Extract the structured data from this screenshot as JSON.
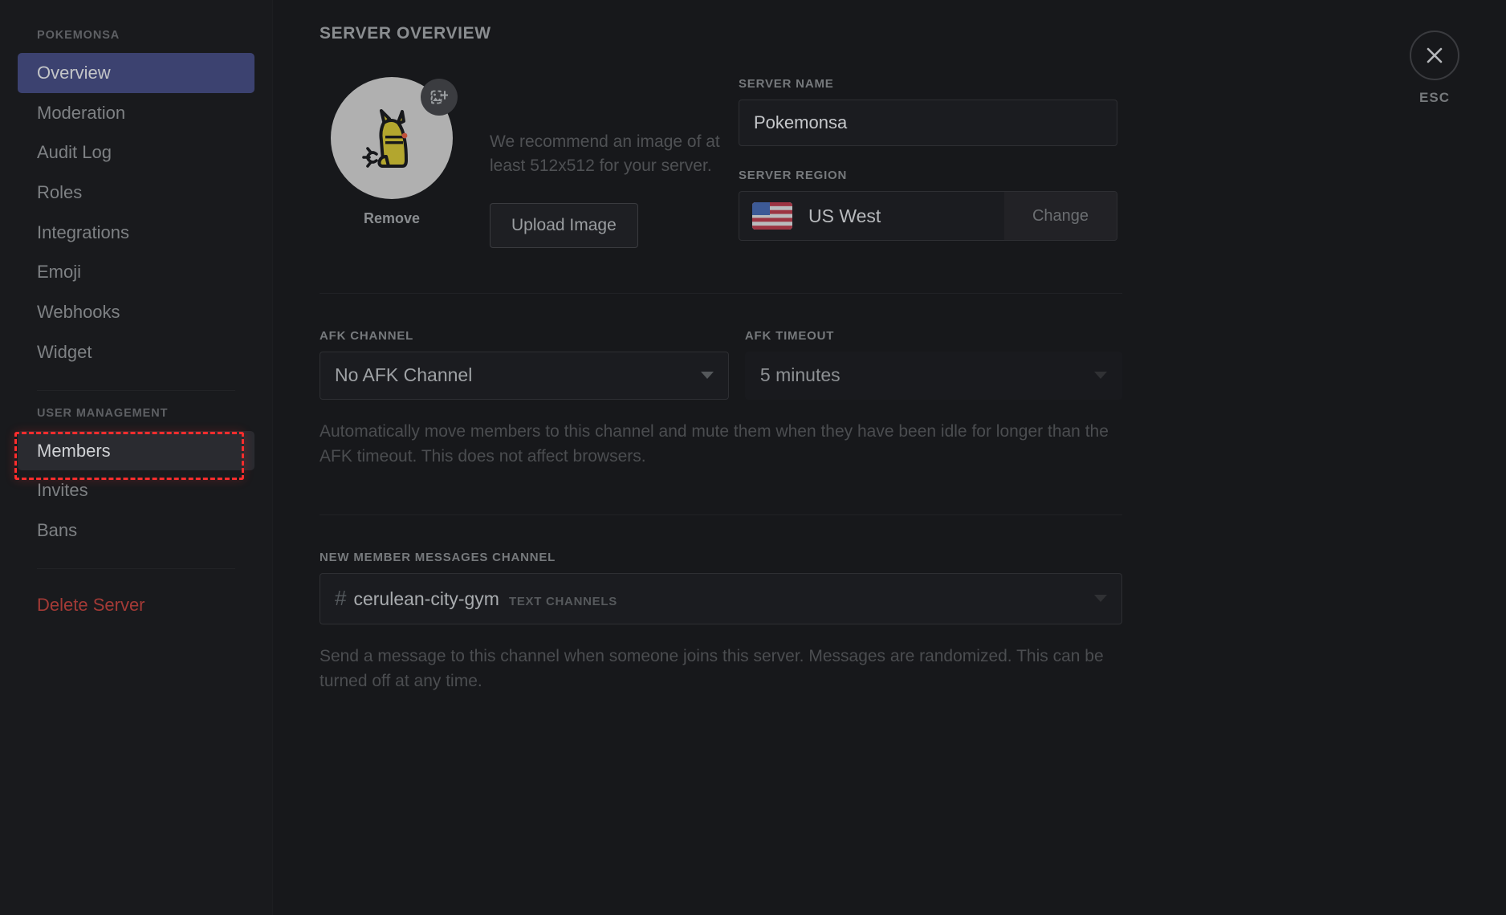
{
  "sidebar": {
    "server_header": "POKEMONSA",
    "items": [
      {
        "label": "Overview",
        "state": "active"
      },
      {
        "label": "Moderation",
        "state": "normal"
      },
      {
        "label": "Audit Log",
        "state": "normal"
      },
      {
        "label": "Roles",
        "state": "normal"
      },
      {
        "label": "Integrations",
        "state": "normal"
      },
      {
        "label": "Emoji",
        "state": "normal"
      },
      {
        "label": "Webhooks",
        "state": "normal"
      },
      {
        "label": "Widget",
        "state": "normal"
      }
    ],
    "user_management_header": "USER MANAGEMENT",
    "user_items": [
      {
        "label": "Members",
        "state": "hovered"
      },
      {
        "label": "Invites",
        "state": "normal"
      },
      {
        "label": "Bans",
        "state": "normal"
      }
    ],
    "delete_server": "Delete Server"
  },
  "header": {
    "title": "SERVER OVERVIEW",
    "esc_label": "ESC",
    "close_icon": "close-icon"
  },
  "server_icon": {
    "remove_label": "Remove",
    "upload_badge_icon": "add-image-icon",
    "avatar_icon": "pikachu-avatar"
  },
  "recommend": {
    "text": "We recommend an image of at least 512x512 for your server.",
    "upload_button": "Upload Image"
  },
  "server_name": {
    "label": "SERVER NAME",
    "value": "Pokemonsa"
  },
  "server_region": {
    "label": "SERVER REGION",
    "value": "US West",
    "flag_icon": "us-flag-icon",
    "change_button": "Change"
  },
  "afk_channel": {
    "label": "AFK CHANNEL",
    "value": "No AFK Channel",
    "caret_icon": "chevron-down-icon"
  },
  "afk_timeout": {
    "label": "AFK TIMEOUT",
    "value": "5 minutes",
    "caret_icon": "chevron-down-icon"
  },
  "afk_help": "Automatically move members to this channel and mute them when they have been idle for longer than the AFK timeout. This does not affect browsers.",
  "new_member_channel": {
    "label": "NEW MEMBER MESSAGES CHANNEL",
    "hash": "#",
    "channel": "cerulean-city-gym",
    "category": "TEXT CHANNELS",
    "caret_icon": "chevron-down-icon",
    "help": "Send a message to this channel when someone joins this server. Messages are randomized. This can be turned off at any time."
  },
  "colors": {
    "accent_active": "#3c4270",
    "danger": "#a33a36",
    "annotation": "#ff2d2d",
    "panel_bg": "#17181b",
    "sidebar_bg": "#191a1d"
  }
}
